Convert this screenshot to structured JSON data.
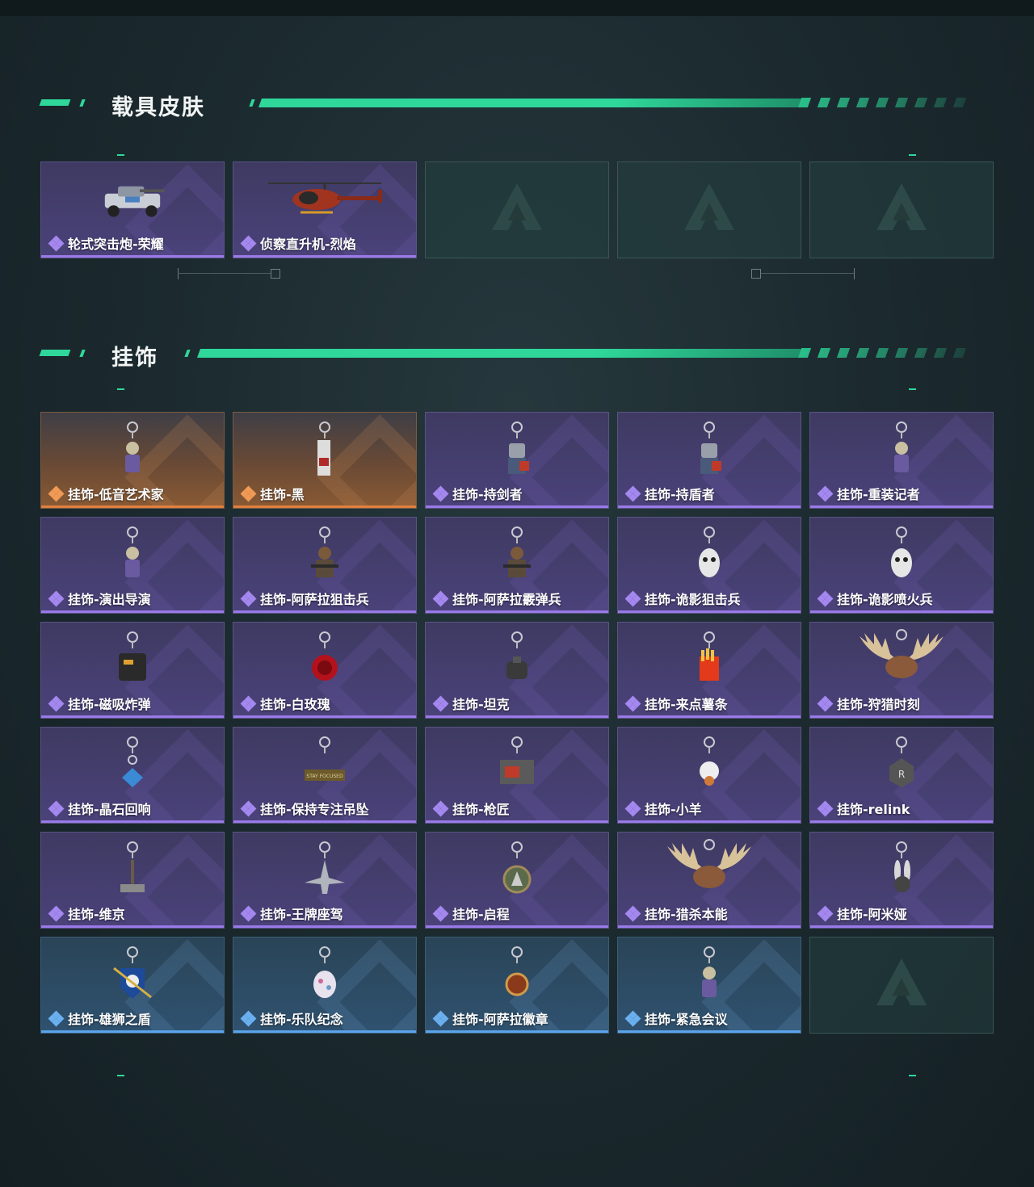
{
  "sections": [
    {
      "title": "载具皮肤",
      "items": [
        {
          "label": "轮式突击炮-荣耀",
          "rarity": "purple",
          "icon": "armored-vehicle-icon"
        },
        {
          "label": "侦察直升机-烈焰",
          "rarity": "purple",
          "icon": "helicopter-icon"
        },
        {
          "label": "",
          "rarity": "empty",
          "icon": "logo-placeholder-icon"
        },
        {
          "label": "",
          "rarity": "empty",
          "icon": "logo-placeholder-icon"
        },
        {
          "label": "",
          "rarity": "empty",
          "icon": "logo-placeholder-icon"
        }
      ]
    },
    {
      "title": "挂饰",
      "items": [
        {
          "label": "挂饰-低音艺术家",
          "rarity": "orange",
          "icon": "figure-charm-icon"
        },
        {
          "label": "挂饰-黑",
          "rarity": "orange",
          "icon": "tag-charm-icon"
        },
        {
          "label": "挂饰-持剑者",
          "rarity": "purple",
          "icon": "knight-charm-icon"
        },
        {
          "label": "挂饰-持盾者",
          "rarity": "purple",
          "icon": "knight-charm-icon"
        },
        {
          "label": "挂饰-重装记者",
          "rarity": "purple",
          "icon": "figure-charm-icon"
        },
        {
          "label": "挂饰-演出导演",
          "rarity": "purple",
          "icon": "figure-charm-icon"
        },
        {
          "label": "挂饰-阿萨拉狙击兵",
          "rarity": "purple",
          "icon": "soldier-charm-icon"
        },
        {
          "label": "挂饰-阿萨拉霰弹兵",
          "rarity": "purple",
          "icon": "soldier-charm-icon"
        },
        {
          "label": "挂饰-诡影狙击兵",
          "rarity": "purple",
          "icon": "ghost-charm-icon"
        },
        {
          "label": "挂饰-诡影喷火兵",
          "rarity": "purple",
          "icon": "ghost-charm-icon"
        },
        {
          "label": "挂饰-磁吸炸弹",
          "rarity": "purple",
          "icon": "bomb-charm-icon"
        },
        {
          "label": "挂饰-白玫瑰",
          "rarity": "purple",
          "icon": "rose-charm-icon"
        },
        {
          "label": "挂饰-坦克",
          "rarity": "purple",
          "icon": "tank-charm-icon"
        },
        {
          "label": "挂饰-来点薯条",
          "rarity": "purple",
          "icon": "fries-charm-icon"
        },
        {
          "label": "挂饰-狩猎时刻",
          "rarity": "purple",
          "icon": "antler-charm-icon"
        },
        {
          "label": "挂饰-晶石回响",
          "rarity": "purple",
          "icon": "crystal-charm-icon"
        },
        {
          "label": "挂饰-保持专注吊坠",
          "rarity": "purple",
          "icon": "plate-charm-icon"
        },
        {
          "label": "挂饰-枪匠",
          "rarity": "purple",
          "icon": "crate-charm-icon"
        },
        {
          "label": "挂饰-小羊",
          "rarity": "purple",
          "icon": "sheep-charm-icon"
        },
        {
          "label": "挂饰-relink",
          "rarity": "purple",
          "icon": "badge-charm-icon"
        },
        {
          "label": "挂饰-维京",
          "rarity": "purple",
          "icon": "hammer-charm-icon"
        },
        {
          "label": "挂饰-王牌座驾",
          "rarity": "purple",
          "icon": "jet-charm-icon"
        },
        {
          "label": "挂饰-启程",
          "rarity": "purple",
          "icon": "medallion-charm-icon"
        },
        {
          "label": "挂饰-猎杀本能",
          "rarity": "purple",
          "icon": "antler-charm-icon"
        },
        {
          "label": "挂饰-阿米娅",
          "rarity": "purple",
          "icon": "bunny-charm-icon"
        },
        {
          "label": "挂饰-雄狮之盾",
          "rarity": "blue",
          "icon": "shield-charm-icon"
        },
        {
          "label": "挂饰-乐队纪念",
          "rarity": "blue",
          "icon": "egg-charm-icon"
        },
        {
          "label": "挂饰-阿萨拉徽章",
          "rarity": "blue",
          "icon": "emblem-charm-icon"
        },
        {
          "label": "挂饰-紧急会议",
          "rarity": "blue",
          "icon": "figure-charm-icon"
        },
        {
          "label": "",
          "rarity": "empty",
          "icon": "logo-placeholder-icon"
        }
      ]
    }
  ],
  "colors": {
    "accent": "#2fd79a",
    "purple": "#9a7ae8",
    "orange": "#e08040",
    "blue": "#5aa4ec"
  }
}
